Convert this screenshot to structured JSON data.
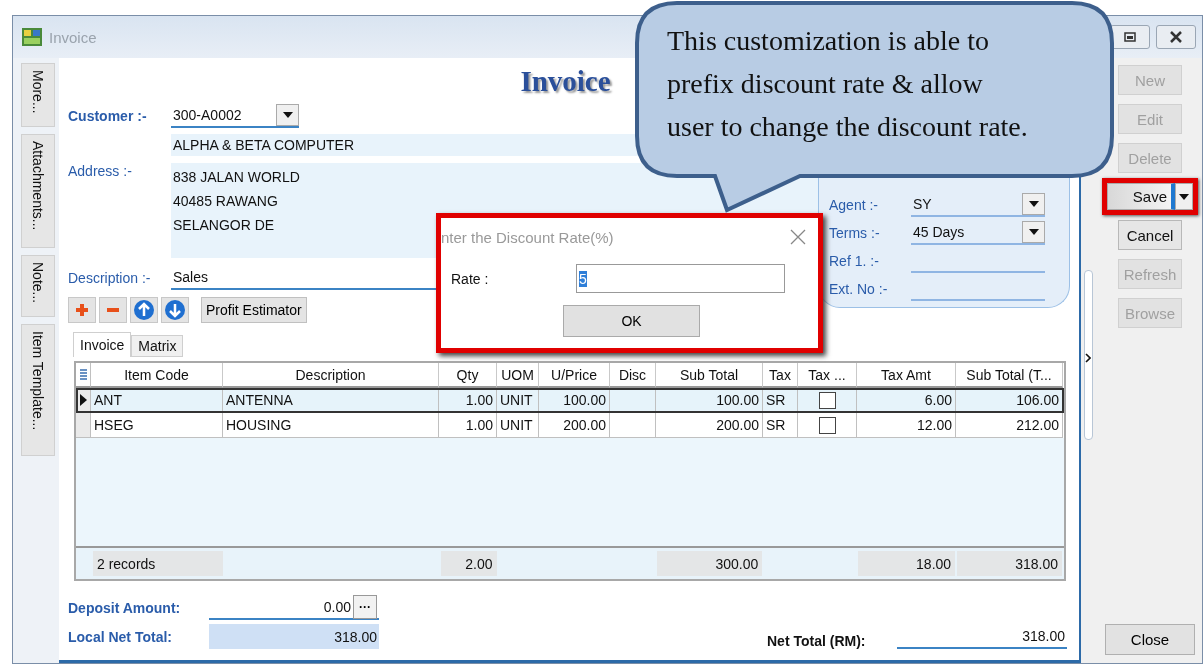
{
  "window": {
    "title": "Invoice"
  },
  "side_tabs": [
    {
      "label": "More..."
    },
    {
      "label": "Attachments..."
    },
    {
      "label": "Note..."
    },
    {
      "label": "Item Template..."
    }
  ],
  "form": {
    "heading": "Invoice",
    "customer": {
      "label": "Customer :-",
      "value": "300-A0002"
    },
    "company_name": "ALPHA & BETA COMPUTER",
    "address": {
      "label": "Address :-",
      "lines": [
        "838 JALAN WORLD",
        "40485 RAWANG",
        "SELANGOR DE"
      ]
    },
    "description": {
      "label": "Description :-",
      "value": "Sales"
    }
  },
  "header_panel": {
    "fields": [
      {
        "label": "Agent :-",
        "value": "SY",
        "kind": "combo"
      },
      {
        "label": "Terms :-",
        "value": "45 Days",
        "kind": "combo"
      },
      {
        "label": "Ref 1. :-",
        "kind": "text"
      },
      {
        "label": "Ext. No :-",
        "kind": "text"
      }
    ]
  },
  "toolbar": {
    "profit_button": "Profit Estimator"
  },
  "tabs": [
    {
      "label": "Invoice",
      "selected": true
    },
    {
      "label": "Matrix",
      "selected": false
    }
  ],
  "grid": {
    "columns": [
      "Item Code",
      "Description",
      "Qty",
      "UOM",
      "U/Price",
      "Disc",
      "Sub Total",
      "Tax",
      "Tax ...",
      "Tax Amt",
      "Sub Total (T..."
    ],
    "rows": [
      {
        "selected": true,
        "item_code": "ANT",
        "description": "ANTENNA",
        "qty": "1.00",
        "uom": "UNIT",
        "u_price": "100.00",
        "sub_total": "100.00",
        "tax": "SR",
        "tax_inclusive": false,
        "tax_amt": "6.00",
        "sub_total_tax": "106.00"
      },
      {
        "selected": false,
        "item_code": "HSEG",
        "description": "HOUSING",
        "qty": "1.00",
        "uom": "UNIT",
        "u_price": "200.00",
        "sub_total": "200.00",
        "tax": "SR",
        "tax_inclusive": false,
        "tax_amt": "12.00",
        "sub_total_tax": "212.00"
      }
    ],
    "footer": {
      "records": "2 records",
      "qty": "2.00",
      "sub_total": "300.00",
      "tax_amt": "18.00",
      "sub_total_tax": "318.00"
    }
  },
  "totals": {
    "deposit": {
      "label": "Deposit Amount:",
      "value": "0.00",
      "button": "···"
    },
    "local_net": {
      "label": "Local Net Total:",
      "value": "318.00"
    },
    "net": {
      "label": "Net Total (RM):",
      "value": "318.00"
    }
  },
  "actions": [
    {
      "label": "New",
      "disabled": true
    },
    {
      "label": "Edit",
      "disabled": true
    },
    {
      "label": "Delete",
      "disabled": true
    },
    {
      "label": "Save",
      "disabled": false,
      "kind": "split",
      "highlighted": true
    },
    {
      "label": "Cancel",
      "disabled": false
    },
    {
      "label": "Refresh",
      "disabled": true
    },
    {
      "label": "Browse",
      "disabled": true
    }
  ],
  "close_button": "Close",
  "dialog": {
    "title": "nter the Discount Rate(%)",
    "rate_label": "Rate :",
    "rate_value": "5",
    "ok": "OK"
  },
  "callout": {
    "text": "This customization is able to\nprefix discount rate & allow\nuser to change the discount rate."
  }
}
